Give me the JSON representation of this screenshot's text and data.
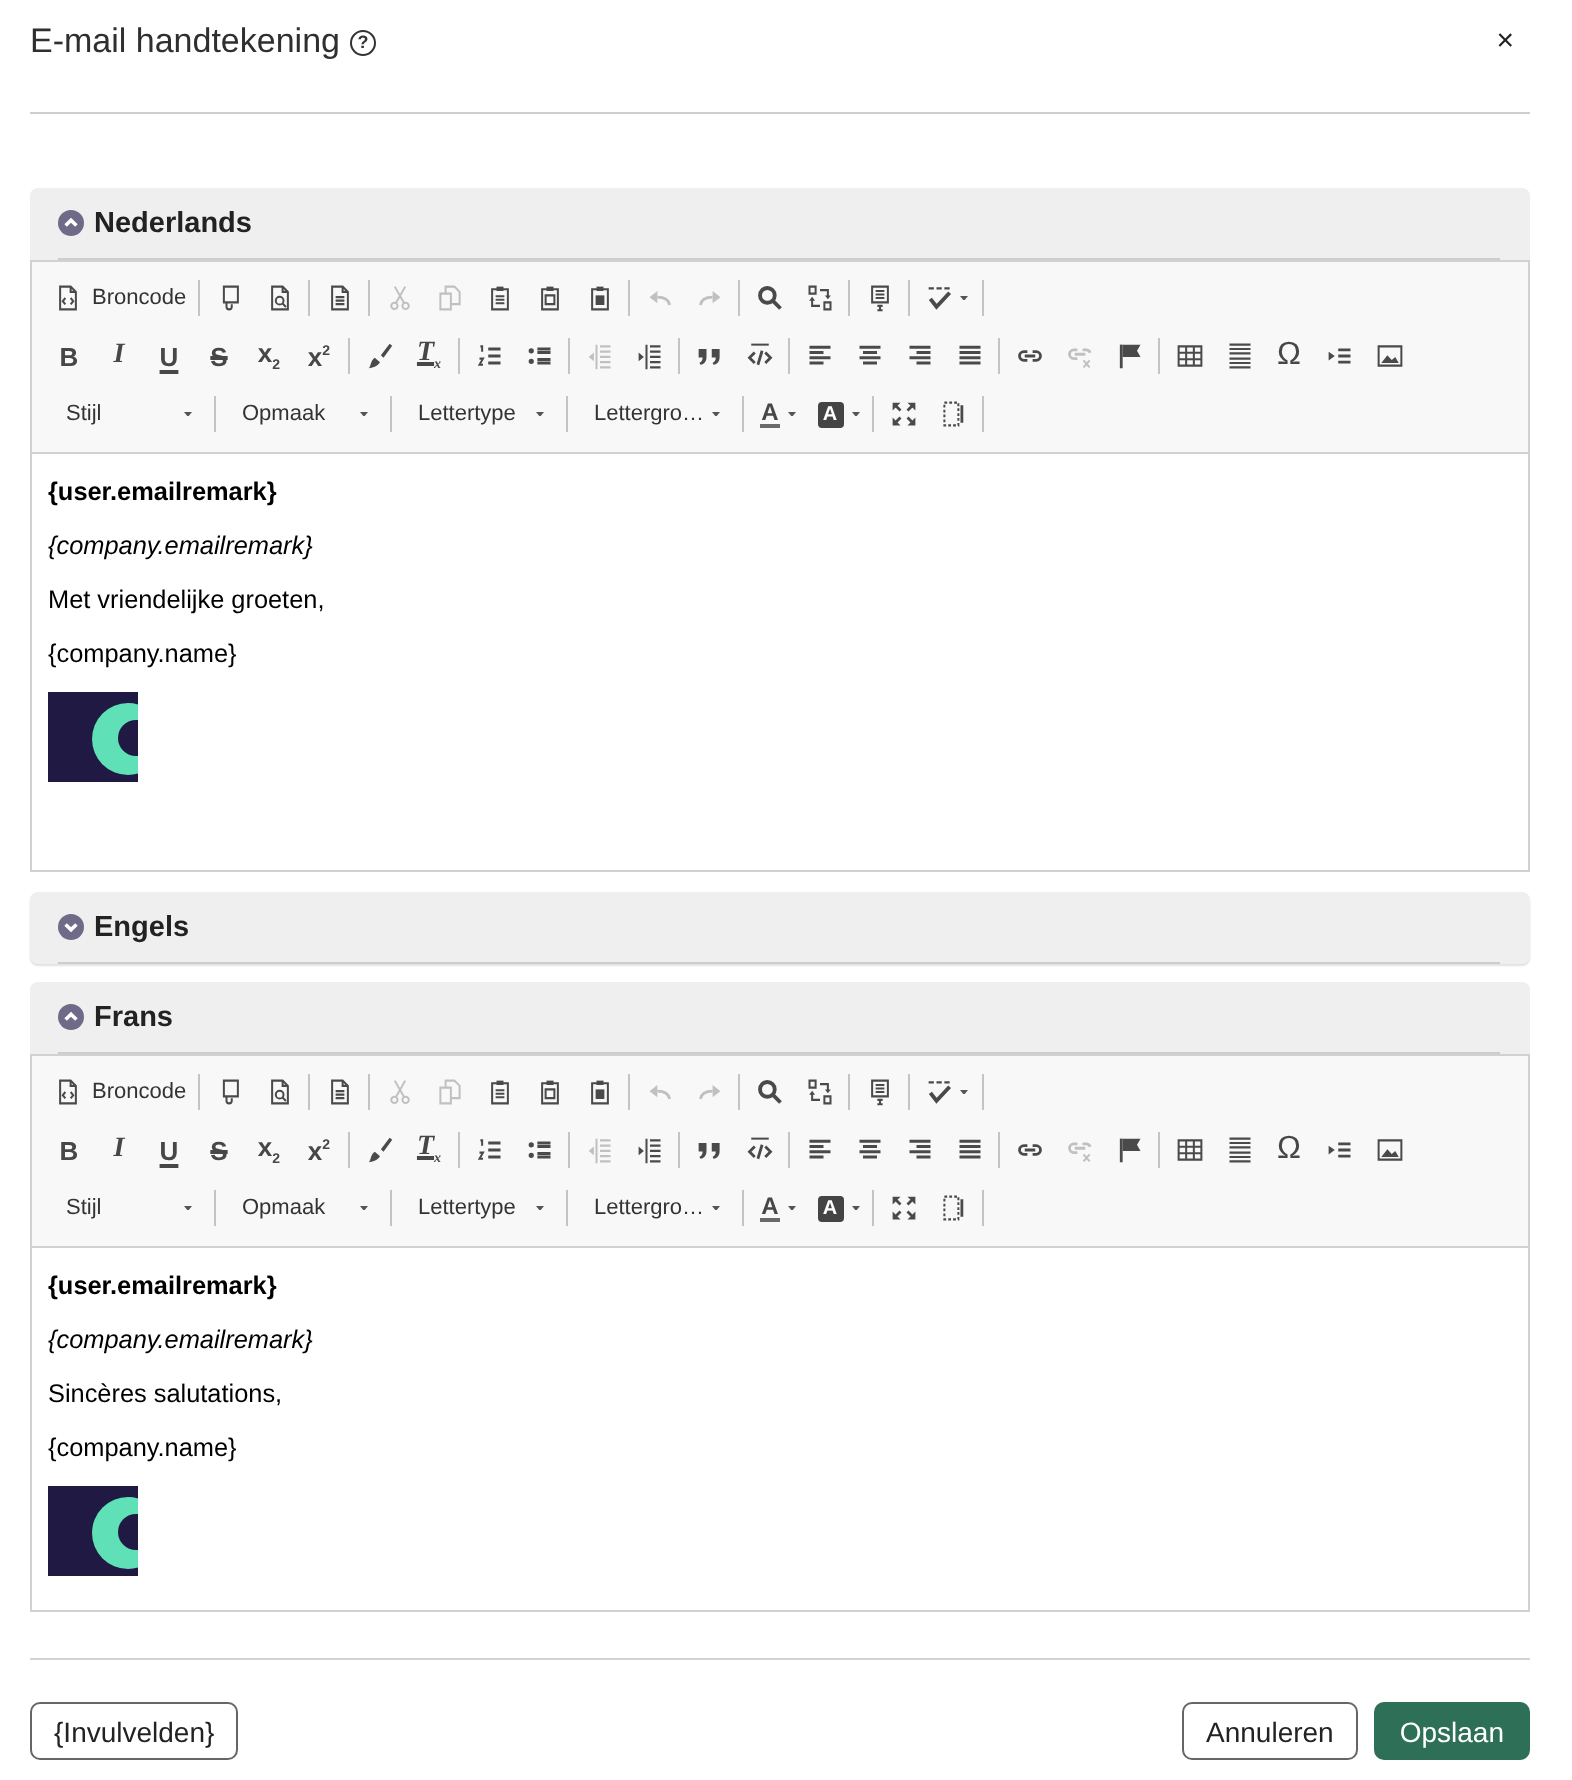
{
  "dialog": {
    "title": "E-mail handtekening",
    "help": "?",
    "close": "×"
  },
  "sections": [
    {
      "title": "Nederlands",
      "expanded": true,
      "editor": {
        "toolbar": {
          "lines": [
            {
              "groups": [
                {
                  "buttons": [
                    {
                      "kind": "source",
                      "label": "Broncode",
                      "disabled": false
                    }
                  ]
                },
                {
                  "buttons": [
                    {
                      "kind": "icon",
                      "disabled": false
                    },
                    {
                      "kind": "icon",
                      "disabled": false
                    }
                  ]
                },
                {
                  "buttons": [
                    {
                      "kind": "icon",
                      "disabled": false
                    }
                  ]
                },
                {
                  "buttons": [
                    {
                      "kind": "icon",
                      "disabled": true
                    },
                    {
                      "kind": "icon",
                      "disabled": true
                    },
                    {
                      "kind": "icon",
                      "disabled": false
                    },
                    {
                      "kind": "icon",
                      "disabled": false
                    },
                    {
                      "kind": "icon",
                      "disabled": false
                    }
                  ]
                },
                {
                  "buttons": [
                    {
                      "kind": "icon",
                      "disabled": true
                    },
                    {
                      "kind": "icon",
                      "disabled": true
                    }
                  ]
                },
                {
                  "buttons": [
                    {
                      "kind": "icon",
                      "disabled": false
                    },
                    {
                      "kind": "icon",
                      "disabled": false
                    }
                  ]
                },
                {
                  "buttons": [
                    {
                      "kind": "icon",
                      "disabled": false
                    }
                  ]
                },
                {
                  "buttons": [
                    {
                      "kind": "iconmenu",
                      "disabled": false
                    }
                  ]
                }
              ]
            },
            {
              "groups": [
                {
                  "buttons": [
                    {
                      "kind": "letter",
                      "label": "B",
                      "disabled": false
                    },
                    {
                      "kind": "letter",
                      "label": "I",
                      "disabled": false
                    },
                    {
                      "kind": "letter",
                      "label": "U",
                      "disabled": false
                    },
                    {
                      "kind": "letter",
                      "label": "S",
                      "disabled": false
                    },
                    {
                      "kind": "letter",
                      "label": "x$_{2}$",
                      "disabled": false
                    },
                    {
                      "kind": "letter",
                      "label": "x$^{2}$",
                      "disabled": false
                    }
                  ]
                },
                {
                  "buttons": [
                    {
                      "kind": "icon",
                      "disabled": false
                    },
                    {
                      "kind": "letter",
                      "label": "T$_{x}$",
                      "disabled": false
                    }
                  ]
                },
                {
                  "buttons": [
                    {
                      "kind": "icon",
                      "disabled": false
                    },
                    {
                      "kind": "icon",
                      "disabled": false
                    }
                  ]
                },
                {
                  "buttons": [
                    {
                      "kind": "icon",
                      "disabled": true
                    },
                    {
                      "kind": "icon",
                      "disabled": false
                    }
                  ]
                },
                {
                  "buttons": [
                    {
                      "kind": "icon",
                      "disabled": false
                    },
                    {
                      "kind": "icon",
                      "disabled": false
                    }
                  ]
                },
                {
                  "buttons": [
                    {
                      "kind": "icon",
                      "disabled": false
                    },
                    {
                      "kind": "icon",
                      "disabled": false
                    },
                    {
                      "kind": "icon",
                      "disabled": false
                    },
                    {
                      "kind": "icon",
                      "disabled": false
                    }
                  ]
                },
                {
                  "buttons": [
                    {
                      "kind": "icon",
                      "disabled": false
                    },
                    {
                      "kind": "icon",
                      "disabled": true
                    },
                    {
                      "kind": "icon",
                      "disabled": false
                    }
                  ]
                },
                {
                  "buttons": [
                    {
                      "kind": "icon",
                      "disabled": false
                    },
                    {
                      "kind": "icon",
                      "disabled": false
                    },
                    {
                      "kind": "letter",
                      "label": "Ω",
                      "disabled": false
                    },
                    {
                      "kind": "icon",
                      "disabled": false
                    },
                    {
                      "kind": "icon",
                      "disabled": false
                    }
                  ]
                }
              ]
            },
            {
              "groups": [
                {
                  "buttons": [
                    {
                      "kind": "dropdown",
                      "label": "Stijl",
                      "disabled": false
                    }
                  ]
                },
                {
                  "buttons": [
                    {
                      "kind": "dropdown",
                      "label": "Opmaak",
                      "disabled": false
                    }
                  ]
                },
                {
                  "buttons": [
                    {
                      "kind": "dropdown",
                      "label": "Lettertype",
                      "disabled": false
                    }
                  ]
                },
                {
                  "buttons": [
                    {
                      "kind": "dropdown",
                      "label": "Lettergro…",
                      "disabled": false
                    }
                  ]
                },
                {
                  "buttons": [
                    {
                      "kind": "textcolor",
                      "label": "A",
                      "disabled": false
                    },
                    {
                      "kind": "bgcolor",
                      "label": "A",
                      "disabled": false
                    }
                  ]
                },
                {
                  "buttons": [
                    {
                      "kind": "icon",
                      "disabled": false
                    },
                    {
                      "kind": "icon",
                      "disabled": false
                    }
                  ]
                }
              ]
            }
          ]
        },
        "content": [
          {
            "kind": "strong",
            "text": "{user.emailremark}"
          },
          {
            "kind": "emphasis",
            "text": "{company.emailremark}"
          },
          {
            "kind": "text",
            "text": "Met vriendelijke groeten,"
          },
          {
            "kind": "text",
            "text": "{company.name}"
          },
          {
            "kind": "image"
          }
        ]
      }
    },
    {
      "title": "Engels",
      "expanded": false
    },
    {
      "title": "Frans",
      "expanded": true,
      "editor": {
        "toolbar": {
          "lines": [
            {
              "groups": [
                {
                  "buttons": [
                    {
                      "kind": "source",
                      "label": "Broncode",
                      "disabled": false
                    }
                  ]
                },
                {
                  "buttons": [
                    {
                      "kind": "icon",
                      "disabled": false
                    },
                    {
                      "kind": "icon",
                      "disabled": false
                    }
                  ]
                },
                {
                  "buttons": [
                    {
                      "kind": "icon",
                      "disabled": false
                    }
                  ]
                },
                {
                  "buttons": [
                    {
                      "kind": "icon",
                      "disabled": true
                    },
                    {
                      "kind": "icon",
                      "disabled": true
                    },
                    {
                      "kind": "icon",
                      "disabled": false
                    },
                    {
                      "kind": "icon",
                      "disabled": false
                    },
                    {
                      "kind": "icon",
                      "disabled": false
                    }
                  ]
                },
                {
                  "buttons": [
                    {
                      "kind": "icon",
                      "disabled": true
                    },
                    {
                      "kind": "icon",
                      "disabled": true
                    }
                  ]
                },
                {
                  "buttons": [
                    {
                      "kind": "icon",
                      "disabled": false
                    },
                    {
                      "kind": "icon",
                      "disabled": false
                    }
                  ]
                },
                {
                  "buttons": [
                    {
                      "kind": "icon",
                      "disabled": false
                    }
                  ]
                },
                {
                  "buttons": [
                    {
                      "kind": "iconmenu",
                      "disabled": false
                    }
                  ]
                }
              ]
            },
            {
              "groups": [
                {
                  "buttons": [
                    {
                      "kind": "letter",
                      "label": "B",
                      "disabled": false
                    },
                    {
                      "kind": "letter",
                      "label": "I",
                      "disabled": false
                    },
                    {
                      "kind": "letter",
                      "label": "U",
                      "disabled": false
                    },
                    {
                      "kind": "letter",
                      "label": "S",
                      "disabled": false
                    },
                    {
                      "kind": "letter",
                      "label": "x$_{2}$",
                      "disabled": false
                    },
                    {
                      "kind": "letter",
                      "label": "x$^{2}$",
                      "disabled": false
                    }
                  ]
                },
                {
                  "buttons": [
                    {
                      "kind": "icon",
                      "disabled": false
                    },
                    {
                      "kind": "letter",
                      "label": "T$_{x}$",
                      "disabled": false
                    }
                  ]
                },
                {
                  "buttons": [
                    {
                      "kind": "icon",
                      "disabled": false
                    },
                    {
                      "kind": "icon",
                      "disabled": false
                    }
                  ]
                },
                {
                  "buttons": [
                    {
                      "kind": "icon",
                      "disabled": true
                    },
                    {
                      "kind": "icon",
                      "disabled": false
                    }
                  ]
                },
                {
                  "buttons": [
                    {
                      "kind": "icon",
                      "disabled": false
                    },
                    {
                      "kind": "icon",
                      "disabled": false
                    }
                  ]
                },
                {
                  "buttons": [
                    {
                      "kind": "icon",
                      "disabled": false
                    },
                    {
                      "kind": "icon",
                      "disabled": false
                    },
                    {
                      "kind": "icon",
                      "disabled": false
                    },
                    {
                      "kind": "icon",
                      "disabled": false
                    }
                  ]
                },
                {
                  "buttons": [
                    {
                      "kind": "icon",
                      "disabled": false
                    },
                    {
                      "kind": "icon",
                      "disabled": true
                    },
                    {
                      "kind": "icon",
                      "disabled": false
                    }
                  ]
                },
                {
                  "buttons": [
                    {
                      "kind": "icon",
                      "disabled": false
                    },
                    {
                      "kind": "icon",
                      "disabled": false
                    },
                    {
                      "kind": "letter",
                      "label": "Ω",
                      "disabled": false
                    },
                    {
                      "kind": "icon",
                      "disabled": false
                    },
                    {
                      "kind": "icon",
                      "disabled": false
                    }
                  ]
                }
              ]
            },
            {
              "groups": [
                {
                  "buttons": [
                    {
                      "kind": "dropdown",
                      "label": "Stijl",
                      "disabled": false
                    }
                  ]
                },
                {
                  "buttons": [
                    {
                      "kind": "dropdown",
                      "label": "Opmaak",
                      "disabled": false
                    }
                  ]
                },
                {
                  "buttons": [
                    {
                      "kind": "dropdown",
                      "label": "Lettertype",
                      "disabled": false
                    }
                  ]
                },
                {
                  "buttons": [
                    {
                      "kind": "dropdown",
                      "label": "Lettergro…",
                      "disabled": false
                    }
                  ]
                },
                {
                  "buttons": [
                    {
                      "kind": "textcolor",
                      "label": "A",
                      "disabled": false
                    },
                    {
                      "kind": "bgcolor",
                      "label": "A",
                      "disabled": false
                    }
                  ]
                },
                {
                  "buttons": [
                    {
                      "kind": "icon",
                      "disabled": false
                    },
                    {
                      "kind": "icon",
                      "disabled": false
                    }
                  ]
                }
              ]
            }
          ]
        },
        "content": [
          {
            "kind": "strong",
            "text": "{user.emailremark}"
          },
          {
            "kind": "emphasis",
            "text": "{company.emailremark}"
          },
          {
            "kind": "text",
            "text": "Sincères salutations,"
          },
          {
            "kind": "text",
            "text": "{company.name}"
          },
          {
            "kind": "image"
          }
        ]
      }
    }
  ],
  "footer": {
    "left_buttons": [
      {
        "label": "{Invulvelden}",
        "kind": "secondary"
      }
    ],
    "right_buttons": [
      {
        "label": "Annuleren",
        "kind": "secondary"
      },
      {
        "label": "Opslaan",
        "kind": "primary"
      }
    ]
  }
}
